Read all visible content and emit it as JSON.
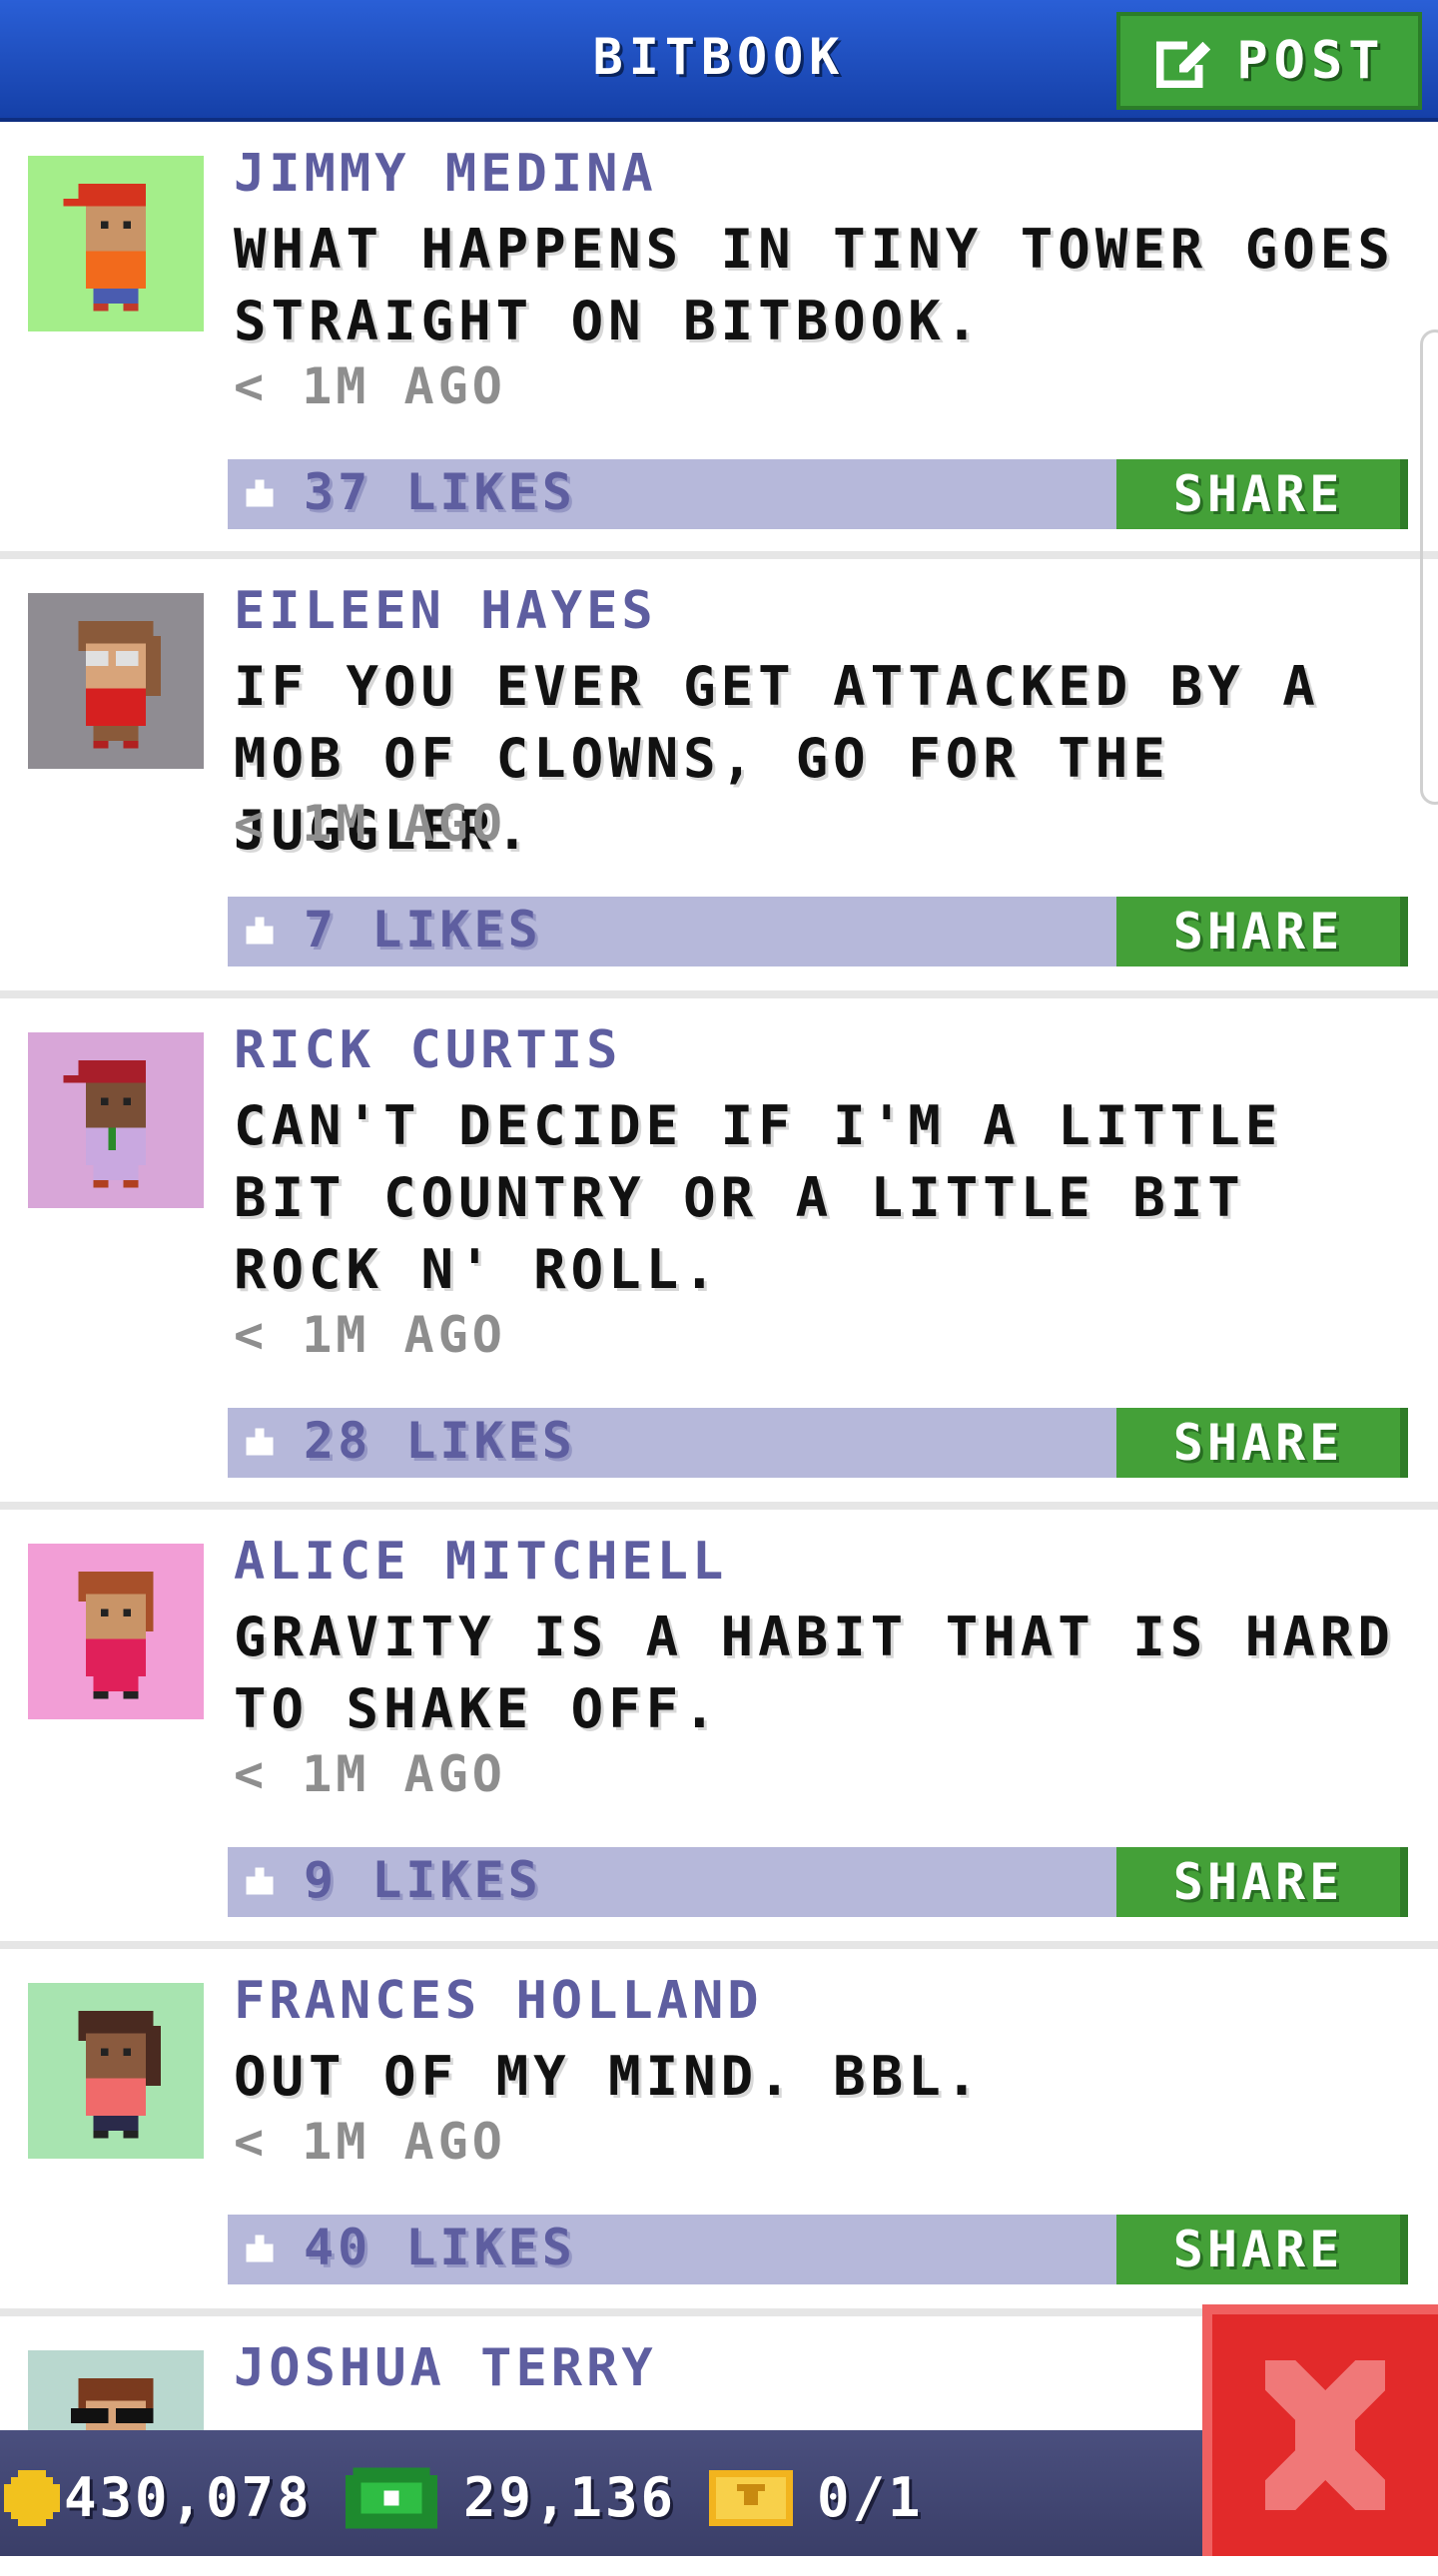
{
  "header": {
    "title": "BITBOOK",
    "post_label": "POST"
  },
  "posts": [
    {
      "name": "JIMMY MEDINA",
      "text": "WHAT HAPPENS IN TINY TOWER GOES STRAIGHT ON BITBOOK.",
      "time": "< 1M AGO",
      "likes": "37 LIKES",
      "share": "SHARE",
      "avatar_bg": "#a4ee8a"
    },
    {
      "name": "EILEEN HAYES",
      "text": "IF YOU EVER GET ATTACKED BY A MOB OF CLOWNS, GO FOR THE JUGGLER.",
      "time": "< 1M AGO",
      "likes": "7 LIKES",
      "share": "SHARE",
      "avatar_bg": "#8f8c92"
    },
    {
      "name": "RICK CURTIS",
      "text": "CAN'T DECIDE IF I'M A LITTLE BIT COUNTRY OR A LITTLE BIT ROCK N' ROLL.",
      "time": "< 1M AGO",
      "likes": "28 LIKES",
      "share": "SHARE",
      "avatar_bg": "#d8a6d8"
    },
    {
      "name": "ALICE MITCHELL",
      "text": "GRAVITY IS A HABIT THAT IS HARD TO SHAKE OFF.",
      "time": "< 1M AGO",
      "likes": "9 LIKES",
      "share": "SHARE",
      "avatar_bg": "#f29ed6"
    },
    {
      "name": "FRANCES HOLLAND",
      "text": "OUT OF MY MIND. BBL.",
      "time": "< 1M AGO",
      "likes": "40 LIKES",
      "share": "SHARE",
      "avatar_bg": "#a8e4b0"
    },
    {
      "name": "JOSHUA TERRY",
      "text": "",
      "time": "",
      "likes": "",
      "share": "",
      "avatar_bg": "#b9d8cf"
    }
  ],
  "footer": {
    "coins": "430,078",
    "bux": "29,136",
    "tickets": "0/1"
  },
  "colors": {
    "header_blue": "#1d4fc0",
    "accent_green": "#44a038",
    "like_bar": "#b6b8da",
    "close_red": "#e22a2a"
  }
}
